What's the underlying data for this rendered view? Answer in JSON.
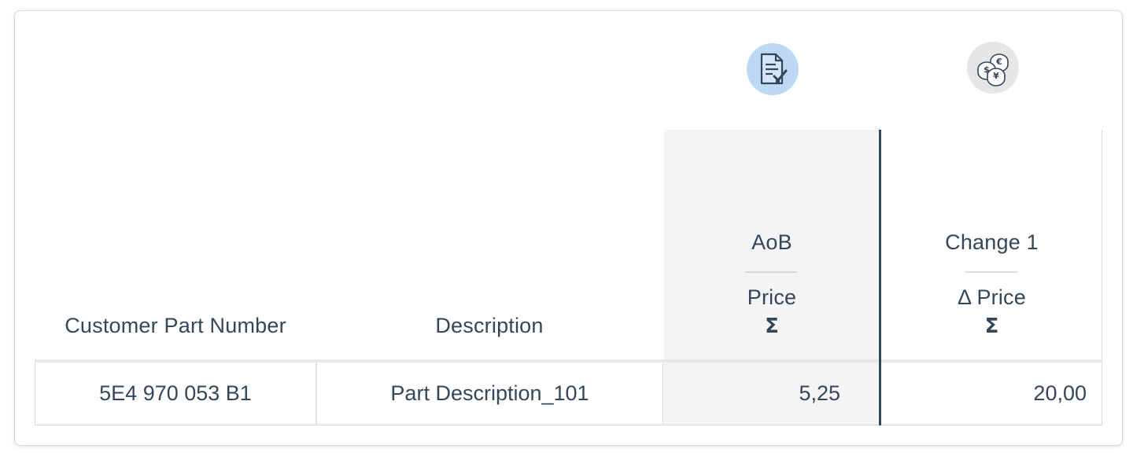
{
  "icons": {
    "aob": "document-check-icon",
    "change": "coins-currency-icon",
    "aob_color": "#bcd8f2",
    "change_color": "#e6e6e6"
  },
  "columns": {
    "part_number": "Customer Part Number",
    "description": "Description",
    "aob": {
      "title": "AoB",
      "subtitle": "Price",
      "aggregate": "Σ"
    },
    "change": {
      "title": "Change 1",
      "subtitle": "Δ Price",
      "aggregate": "Σ"
    }
  },
  "rows": [
    {
      "part_number": "5E4 970 053 B1",
      "description": "Part Description_101",
      "aob_price": "5,25",
      "change_price": "20,00"
    }
  ],
  "colors": {
    "text": "#34475a",
    "accent_divider": "#34475a",
    "highlight_column": "#f4f4f4"
  }
}
